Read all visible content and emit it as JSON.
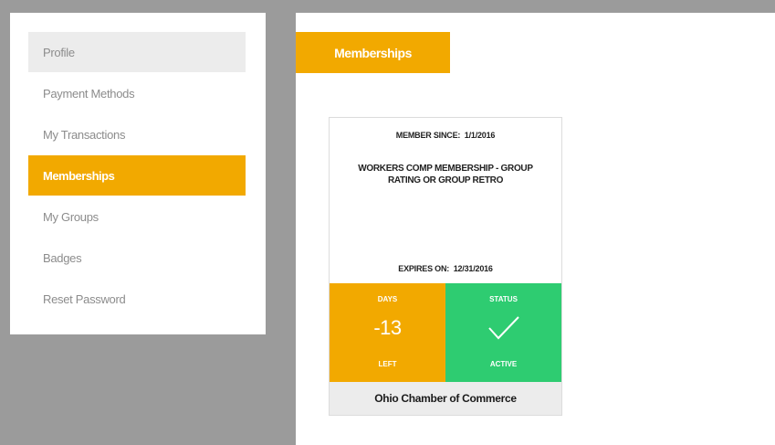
{
  "sidebar": {
    "items": [
      {
        "label": "Profile"
      },
      {
        "label": "Payment Methods"
      },
      {
        "label": "My Transactions"
      },
      {
        "label": "Memberships"
      },
      {
        "label": "My Groups"
      },
      {
        "label": "Badges"
      },
      {
        "label": "Reset Password"
      }
    ],
    "active_index": 3
  },
  "page": {
    "tab_label": "Memberships"
  },
  "membership": {
    "member_since_label": "MEMBER SINCE:",
    "member_since_value": "1/1/2016",
    "title": "WORKERS COMP MEMBERSHIP - GROUP RATING OR GROUP RETRO",
    "expires_label": "EXPIRES ON:",
    "expires_value": "12/31/2016",
    "days_top": "DAYS",
    "days_value": "-13",
    "days_bottom": "LEFT",
    "status_top": "STATUS",
    "status_bottom": "ACTIVE",
    "status_icon": "check-icon",
    "organization": "Ohio Chamber of Commerce"
  },
  "colors": {
    "accent": "#f2a900",
    "status_active": "#2ecc71",
    "background": "#9b9b9b"
  }
}
